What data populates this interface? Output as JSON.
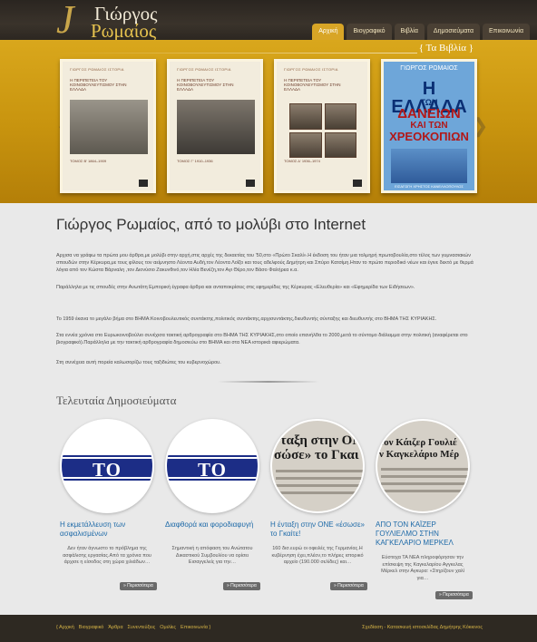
{
  "header": {
    "logo_mono": "J",
    "logo_line1": "Γιώργος",
    "logo_line2": "Ρωμαίος",
    "nav": [
      "Αρχική",
      "Βιογραφικό",
      "Βιβλία",
      "Δημοσιεύματα",
      "Επικοινωνία"
    ],
    "nav_active": 0
  },
  "slider": {
    "section_title": "{ Τα Βιβλία }",
    "books": [
      {
        "series": "ΓΙΩΡΓΟΣ ΡΩΜΑΙΟΣ ΙΣΤΟΡΙΑ",
        "title": "Η ΠΕΡΙΠΕΤΕΙΑ ΤΟΥ ΚΟΙΝΟΒΟΥΛΕΥΤΙΣΜΟΥ ΣΤΗΝ ΕΛΛΑΔΑ",
        "volume": "ΤΟΜΟΣ Β' 1864–1909"
      },
      {
        "series": "ΓΙΩΡΓΟΣ ΡΩΜΑΙΟΣ ΙΣΤΟΡΙΑ",
        "title": "Η ΠΕΡΙΠΕΤΕΙΑ ΤΟΥ ΚΟΙΝΟΒΟΥΛΕΥΤΙΣΜΟΥ ΣΤΗΝ ΕΛΛΑΔΑ",
        "volume": "ΤΟΜΟΣ Γ' 1910–1936"
      },
      {
        "series": "ΓΙΩΡΓΟΣ ΡΩΜΑΙΟΣ ΙΣΤΟΡΙΑ",
        "title": "Η ΠΕΡΙΠΕΤΕΙΑ ΤΟΥ ΚΟΙΝΟΒΟΥΛΕΥΤΙΣΜΟΥ ΣΤΗΝ ΕΛΛΑΔΑ",
        "volume": "ΤΟΜΟΣ Δ' 1936–1974"
      },
      {
        "author": "ΓΙΩΡΓΟΣ ΡΩΜΑΙΟΣ",
        "line1": "Η ΕΛΛΑΔΑ",
        "line2": "ΤΩΝ",
        "line3": "ΔΑΝΕΙΩΝ",
        "line4": "ΚΑΙ ΤΩΝ",
        "line5": "ΧΡΕΟΚΟΠΙΩΝ",
        "subtitle": "ΕΙΣΑΓΩΓΗ ΧΡΗΣΤΟΣ ΚΑΝΕΛΛΟΠΟΥΛΟΣ"
      }
    ],
    "arrow_left": "❮",
    "arrow_right": "❯"
  },
  "intro": {
    "title": "Γιώργος Ρωμαίος, από το μολύβι στο Internet",
    "p1": "Αρχισα να γράφω τα πρώτα μου άρθρα,με μολύβι στην αρχή,στις αρχές της δεκαετίας του '50,στο «Πρώτο Σκαλί».Η έκδοση του ήταν μια τολμηρή πρωτοβουλία,στο τέλος των γυμνασιακών σπουδών στην Κέρκυρα,με τους φίλους τον αείμνηστο Λέοντα Αυδή,τον Λέοντα Λοΐζο και τους αδελφούς Δημήτρη και Σπύρο Κατσίμη.Ηταν το πρώτο περιοδικό νέων και έγινε δεκτό με θερμά λόγια από τον Κώστα Βάρναλη ,τον Διονύσιο Ζακυνθινό,τον Ηλία Βενέζη,τον Αγι Θέρο,τον Βάσο Φαλήρεα κ.α.",
    "p2": "Παράλληλα με τις σπουδές στην Ανωτάτη Εμπορική έγραφα άρθρα και ανταποκρίσεις στις εφημερίδες της Κέρκυρας «Ελευθερία» και «Εφημερίδα των Ειδήσεων».",
    "p3": "Το 1959 έκανα το μεγάλο βήμα στο ΒΗΜΑ:Κοινοβουλευτικός συντάκτης,πολιτικός συντάκτης,αρχισυντάκτης,διευθυντής σύνταξης και διευθυντής στο ΒΗΜΑ ΤΗΣ ΚΥΡΙΑΚΗΣ.",
    "p4": "Στα εννέα χρόνια στο Ευρωκοινοβούλιο συνέχισα τακτική αρθρογραφία στο ΒΗΜΑ ΤΗΣ ΚΥΡΙΑΚΗΣ,στο οποίο επανήλθα το 2000,μετά το σύντομο διάλειμμα στην πολιτική (αναφέρεται στο βιογραφικό).Παράλληλα με την τακτική αρθρογραφία δημοσιεύω στο ΒΗΜΑ και στα ΝΕΑ ιστορικά αφιερώματα.",
    "p5": "Στη συνέχεια αυτή πορεία καλωσορίζω τους ταξιδιώτες του κυβερνοχώρου."
  },
  "posts": {
    "section_title": "Τελευταία Δημοσιεύματα",
    "vima_label": "ΤΟ ΒΗΜΑ",
    "more_label": "» Περισσότερα",
    "items": [
      {
        "title": "Η εκμετάλλευση των ασφαλισμένων",
        "excerpt": "Δεν ήταν άγνωστο το πρόβλημα της ασφάλισης εργασίας.Από τα χρόνια που άρχισε η είσοδος στη χώρα χιλιάδων…",
        "image": "vima"
      },
      {
        "title": "Διαφθορά και φοροδιαφυγή",
        "excerpt": "Σημαντική η απόφαση του Ανώτατου Δικαστικού Συμβουλίου να ορίσει Εισαγγελείς για την…",
        "image": "vima"
      },
      {
        "title": "Η ένταξη στην ΟΝΕ «έσωσε» το Γκαίτε!",
        "excerpt": "160 δισ.ευρώ οι οφειλές της Γερμανίας.Η κυβέρνηση έχει,πλέον,το πλήρες ιστορικό αρχείο (190.000 σελίδες) και…",
        "image": "news",
        "news_lines": [
          "νταξη στην ΟΝ",
          "σώσε» το Γκαι"
        ]
      },
      {
        "title": "ΑΠΟ ΤΟΝ ΚΑΪΖΕΡ ΓΟΥΛΙΕΛΜΟ ΣΤΗΝ ΚΑΓΚΕΛΑΡΙΟ ΜΕΡΚΕΛ",
        "excerpt": "Εύστοχα ΤΑ ΝΕΑ πληροφόρησαν την επίσκεψη της Καγκελαρίου Αγγκελας Μέρκελ στην Αγκυρα: «Στηρίζουν χαλί για…",
        "image": "news",
        "news_lines": [
          "τον Κάιζερ Γουλιέ",
          "ν Καγκελάριο Μέρ"
        ]
      }
    ]
  },
  "footer": {
    "nav": [
      "{ Αρχική",
      "Βιογραφικό",
      "Άρθρα",
      "Συνεντεύξεις",
      "Ομιλίες",
      "Επικοινωνία }"
    ],
    "credit": "Σχεδίαση - Κατασκευή ιστοσελίδας Δημήτρης Κόκκινος"
  },
  "colors": {
    "accent": "#d8a526",
    "header_bg": "#2a2520",
    "link": "#1e6aa8"
  }
}
